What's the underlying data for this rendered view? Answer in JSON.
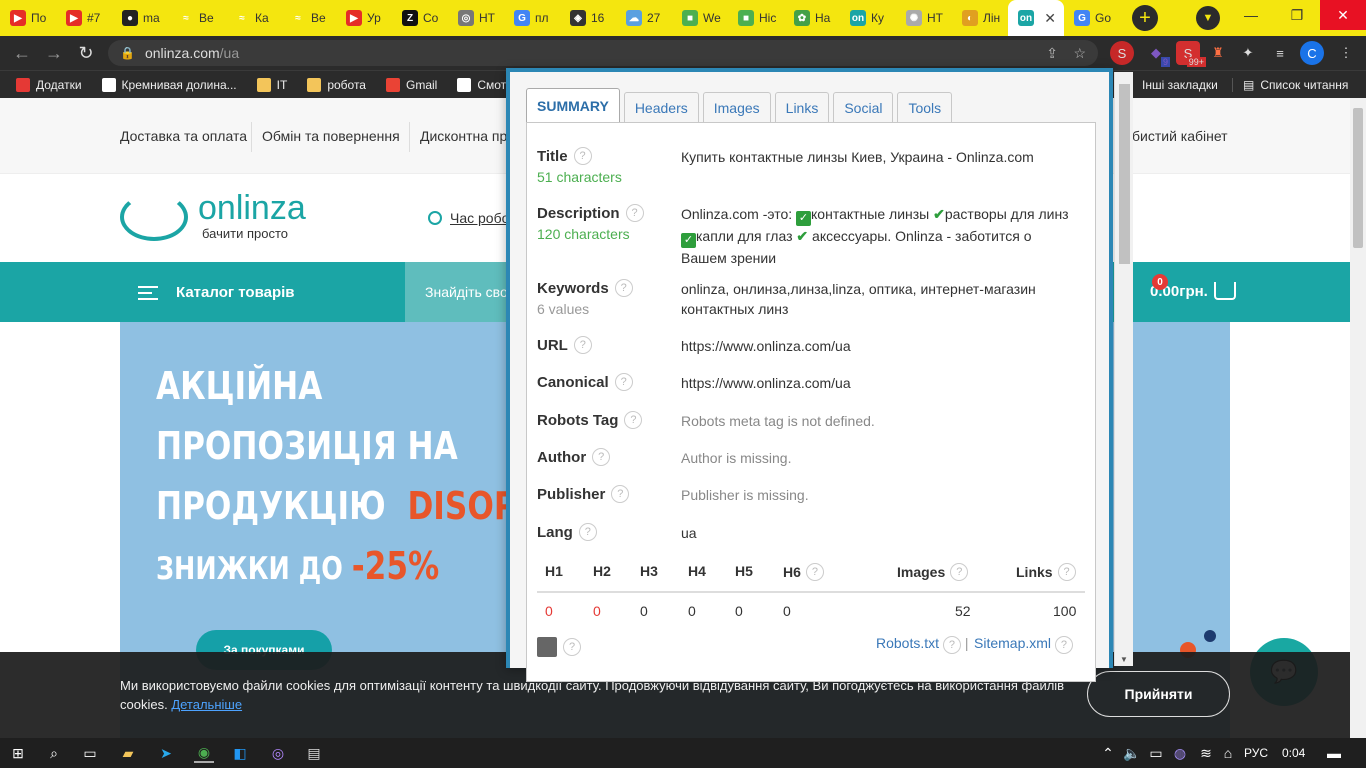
{
  "browser": {
    "tabs": [
      {
        "label": "По",
        "fav_color": "#e52d27",
        "fav_glyph": "▶"
      },
      {
        "label": "#7",
        "fav_color": "#e52d27",
        "fav_glyph": "▶"
      },
      {
        "label": "ma",
        "fav_color": "#222222",
        "fav_glyph": "●"
      },
      {
        "label": "Ве",
        "fav_color": "#f4e60f",
        "fav_glyph": "≈"
      },
      {
        "label": "Ка",
        "fav_color": "#f4e60f",
        "fav_glyph": "≈"
      },
      {
        "label": "Ве",
        "fav_color": "#f4e60f",
        "fav_glyph": "≈"
      },
      {
        "label": "Ур",
        "fav_color": "#e52d27",
        "fav_glyph": "▶"
      },
      {
        "label": "Со",
        "fav_color": "#111111",
        "fav_glyph": "Z"
      },
      {
        "label": "НТ",
        "fav_color": "#777777",
        "fav_glyph": "◎"
      },
      {
        "label": "пл",
        "fav_color": "#4285f4",
        "fav_glyph": "G"
      },
      {
        "label": "16",
        "fav_color": "#333333",
        "fav_glyph": "◈"
      },
      {
        "label": "27",
        "fav_color": "#5aa0e0",
        "fav_glyph": "☁"
      },
      {
        "label": "We",
        "fav_color": "#4caf50",
        "fav_glyph": "■"
      },
      {
        "label": "Ніс",
        "fav_color": "#4caf50",
        "fav_glyph": "■"
      },
      {
        "label": "На",
        "fav_color": "#43a047",
        "fav_glyph": "✿"
      },
      {
        "label": "Ку",
        "fav_color": "#1ba5a5",
        "fav_glyph": "on"
      },
      {
        "label": "НТ",
        "fav_color": "#aaaaaa",
        "fav_glyph": "✺"
      },
      {
        "label": "Лін",
        "fav_color": "#e0a020",
        "fav_glyph": "◐"
      },
      {
        "label": "",
        "fav_color": "#1ba5a5",
        "fav_glyph": "on",
        "active": true
      },
      {
        "label": "Go",
        "fav_color": "#4285f4",
        "fav_glyph": "G"
      }
    ],
    "new_tab_icon": "+",
    "tab_close_icon": "✕",
    "url": {
      "domain": "onlinza.com",
      "path": "/ua"
    },
    "bookmarks": [
      {
        "label": "Додатки",
        "icon_color": "#e53935"
      },
      {
        "label": "Кремнивая долина...",
        "icon_color": "#ffffff"
      },
      {
        "label": "IT",
        "icon_color": "#f3c55a"
      },
      {
        "label": "робота",
        "icon_color": "#f3c55a"
      },
      {
        "label": "Gmail",
        "icon_color": "#ea4335"
      },
      {
        "label": "Смот",
        "icon_color": "#ffffff"
      }
    ],
    "bookmarks_right": [
      "Інші закладки",
      "Список читання"
    ],
    "profile_initial": "C",
    "ext_badges": {
      "nine": "9",
      "ninetynine": "99+"
    }
  },
  "site": {
    "top_menu": [
      "Доставка та оплата",
      "Обмін та повернення",
      "Дисконтна пр",
      "бистий кабінет"
    ],
    "logo": {
      "name": "onlinza",
      "tagline": "бачити просто"
    },
    "hours_link": "Час робо",
    "catalog_label": "Каталог товарів",
    "search_placeholder": "Знайдіть сво",
    "cart": {
      "count": "0",
      "total": "0.00грн."
    },
    "banner": {
      "line1": "АКЦІЙНА",
      "line2": "ПРОПОЗИЦІЯ НА",
      "line3": "ПРОДУКЦІЮ",
      "brand": "DISOP",
      "line4": "ЗНИЖКИ ДО",
      "discount": "-25%",
      "button": "За покупками"
    },
    "cookie": {
      "text": "Ми використовуємо файли cookies для оптимізації контенту та швидкодії сайту. Продовжуючи відвідування сайту, Ви погоджуєтесь на використання файлів cookies.",
      "more": "Детальніше",
      "accept": "Прийняти"
    }
  },
  "seo_popup": {
    "tabs": [
      "SUMMARY",
      "Headers",
      "Images",
      "Links",
      "Social",
      "Tools"
    ],
    "title": {
      "label": "Title",
      "sub": "51 characters",
      "value": "Купить контактные линзы Киев, Украина - Onlinza.com"
    },
    "description": {
      "label": "Description",
      "sub": "120 characters",
      "p1": "Onlinza.com -это:",
      "p2": "контактные линзы",
      "p3": "растворы для линз",
      "p4": "капли для глаз",
      "p5": "аксессуары. Onlinza - заботится о Вашем зрении"
    },
    "keywords": {
      "label": "Keywords",
      "sub": "6 values",
      "value": "onlinza, онлинза,линза,linza, оптика, интернет-магазин контактных линз"
    },
    "url": {
      "label": "URL",
      "value": "https://www.onlinza.com/ua"
    },
    "canonical": {
      "label": "Canonical",
      "value": "https://www.onlinza.com/ua"
    },
    "robots": {
      "label": "Robots Tag",
      "value": "Robots meta tag is not defined."
    },
    "author": {
      "label": "Author",
      "value": "Author is missing."
    },
    "publisher": {
      "label": "Publisher",
      "value": "Publisher is missing."
    },
    "lang": {
      "label": "Lang",
      "value": "ua"
    },
    "headings": {
      "cols": [
        "H1",
        "H2",
        "H3",
        "H4",
        "H5",
        "H6"
      ],
      "values": [
        "0",
        "0",
        "0",
        "0",
        "0",
        "0"
      ],
      "images_label": "Images",
      "images_value": "52",
      "links_label": "Links",
      "links_value": "100"
    },
    "help_icon": "?",
    "footer": {
      "robots": "Robots.txt",
      "sitemap": "Sitemap.xml",
      "divider": "|"
    }
  },
  "taskbar": {
    "lang": "РУС",
    "time": "0:04"
  }
}
